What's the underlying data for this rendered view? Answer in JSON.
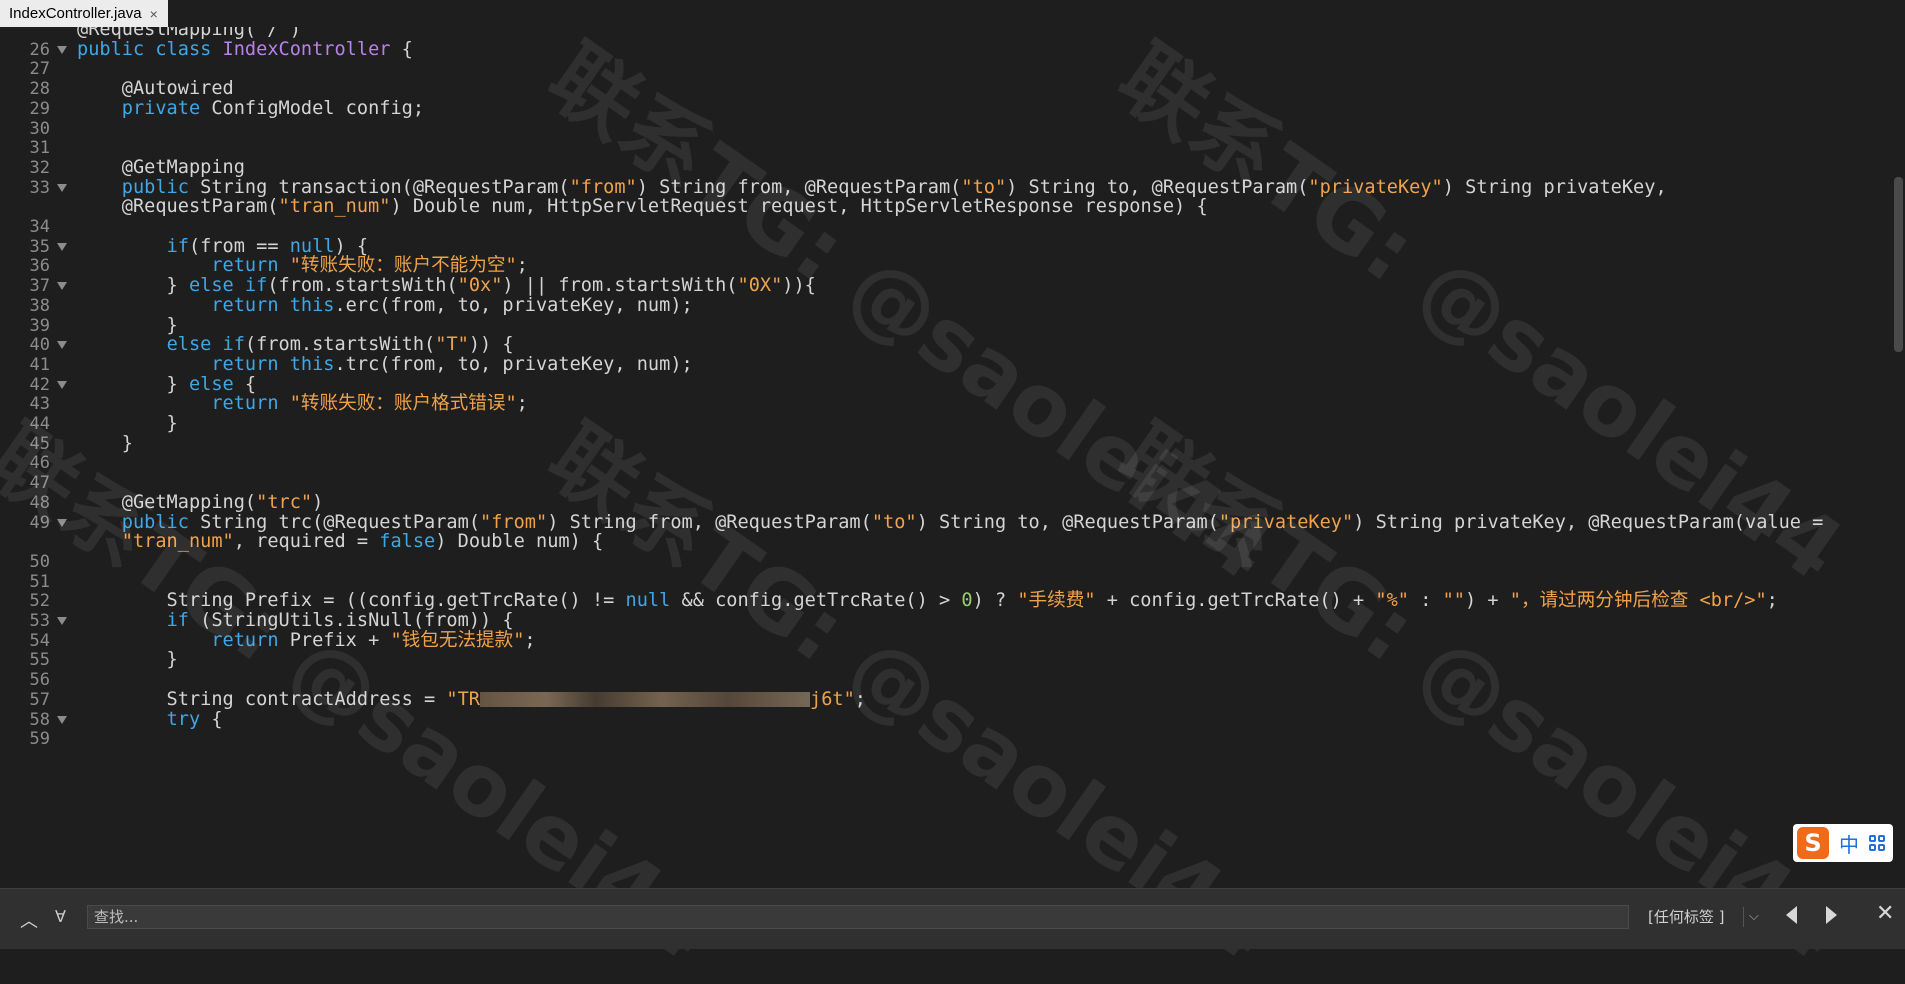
{
  "tab": {
    "title": "IndexController.java",
    "close": "×"
  },
  "watermark": "联系TG: @saolei44",
  "editor": {
    "lines": [
      {
        "n": "",
        "fold": false,
        "code": "@RequestMapping(\"/\")",
        "partial": true
      },
      {
        "n": "26",
        "fold": true,
        "code": "<span class=\"kw\">public class</span> <span class=\"cls\">IndexController</span> {"
      },
      {
        "n": "27",
        "fold": false,
        "code": ""
      },
      {
        "n": "28",
        "fold": false,
        "code": "    @Autowired"
      },
      {
        "n": "29",
        "fold": false,
        "code": "    <span class=\"kw\">private</span> ConfigModel config;"
      },
      {
        "n": "30",
        "fold": false,
        "code": ""
      },
      {
        "n": "31",
        "fold": false,
        "code": ""
      },
      {
        "n": "32",
        "fold": false,
        "code": "    @GetMapping"
      },
      {
        "n": "33",
        "fold": true,
        "code": "    <span class=\"kw\">public</span> String transaction(@RequestParam(<span class=\"str\">\"from\"</span>) String from, @RequestParam(<span class=\"str\">\"to\"</span>) String to, @RequestParam(<span class=\"str\">\"privateKey\"</span>) String privateKey,"
      },
      {
        "n": "",
        "fold": false,
        "code": "    @RequestParam(<span class=\"str\">\"tran_num\"</span>) Double num, HttpServletRequest request, HttpServletResponse response) {"
      },
      {
        "n": "34",
        "fold": false,
        "code": ""
      },
      {
        "n": "35",
        "fold": true,
        "code": "        <span class=\"kw\">if</span>(from == <span class=\"kw\">null</span>) {"
      },
      {
        "n": "36",
        "fold": false,
        "code": "            <span class=\"kw\">return</span> <span class=\"str\">\"转账失败：账户不能为空\"</span>;"
      },
      {
        "n": "37",
        "fold": true,
        "code": "        } <span class=\"kw\">else if</span>(from.startsWith(<span class=\"str\">\"0x\"</span>) || from.startsWith(<span class=\"str\">\"0X\"</span>)){"
      },
      {
        "n": "38",
        "fold": false,
        "code": "            <span class=\"kw\">return this</span>.erc(from, to, privateKey, num);"
      },
      {
        "n": "39",
        "fold": false,
        "code": "        }"
      },
      {
        "n": "40",
        "fold": true,
        "code": "        <span class=\"kw\">else if</span>(from.startsWith(<span class=\"str\">\"T\"</span>)) {"
      },
      {
        "n": "41",
        "fold": false,
        "code": "            <span class=\"kw\">return this</span>.trc(from, to, privateKey, num);"
      },
      {
        "n": "42",
        "fold": true,
        "code": "        } <span class=\"kw\">else</span> {"
      },
      {
        "n": "43",
        "fold": false,
        "code": "            <span class=\"kw\">return</span> <span class=\"str\">\"转账失败：账户格式错误\"</span>;"
      },
      {
        "n": "44",
        "fold": false,
        "code": "        }"
      },
      {
        "n": "45",
        "fold": false,
        "code": "    }"
      },
      {
        "n": "46",
        "fold": false,
        "code": ""
      },
      {
        "n": "47",
        "fold": false,
        "code": ""
      },
      {
        "n": "48",
        "fold": false,
        "code": "    @GetMapping(<span class=\"str\">\"trc\"</span>)"
      },
      {
        "n": "49",
        "fold": true,
        "code": "    <span class=\"kw\">public</span> String trc(@RequestParam(<span class=\"str\">\"from\"</span>) String from, @RequestParam(<span class=\"str\">\"to\"</span>) String to, @RequestParam(<span class=\"str\">\"privateKey\"</span>) String privateKey, @RequestParam(value ="
      },
      {
        "n": "",
        "fold": false,
        "code": "    <span class=\"str\">\"tran_num\"</span>, required = <span class=\"kw\">false</span>) Double num) {"
      },
      {
        "n": "50",
        "fold": false,
        "code": ""
      },
      {
        "n": "51",
        "fold": false,
        "code": ""
      },
      {
        "n": "52",
        "fold": false,
        "code": "        String Prefix = ((config.getTrcRate() != <span class=\"kw\">null</span> &amp;&amp; config.getTrcRate() &gt; <span class=\"num\">0</span>) ? <span class=\"str\">\"手续费\"</span> + config.getTrcRate() + <span class=\"str\">\"%\"</span> : <span class=\"str\">\"\"</span>) + <span class=\"str\">\"，请过两分钟后检查 &lt;br/&gt;\"</span>;"
      },
      {
        "n": "53",
        "fold": true,
        "code": "        <span class=\"kw\">if</span> (StringUtils.isNull(from)) {"
      },
      {
        "n": "54",
        "fold": false,
        "code": "            <span class=\"kw\">return</span> Prefix + <span class=\"str\">\"钱包无法提款\"</span>;"
      },
      {
        "n": "55",
        "fold": false,
        "code": "        }"
      },
      {
        "n": "56",
        "fold": false,
        "code": ""
      },
      {
        "n": "57",
        "fold": false,
        "code": "        String contractAddress = <span class=\"str\">\"TR<span class=\"blur\" style=\"width:330px\"></span>j6t\"</span>;"
      },
      {
        "n": "58",
        "fold": true,
        "code": "        <span class=\"kw\">try</span> {"
      },
      {
        "n": "59",
        "fold": false,
        "code": "",
        "partial": true
      }
    ]
  },
  "ime": {
    "logo": "S",
    "mode": "中"
  },
  "search": {
    "up_icon": "︿",
    "filter_icon": "∀",
    "placeholder": "查找...",
    "scope": "[任何标签 ]",
    "scope_chevron": "⌵",
    "close": "✕"
  }
}
